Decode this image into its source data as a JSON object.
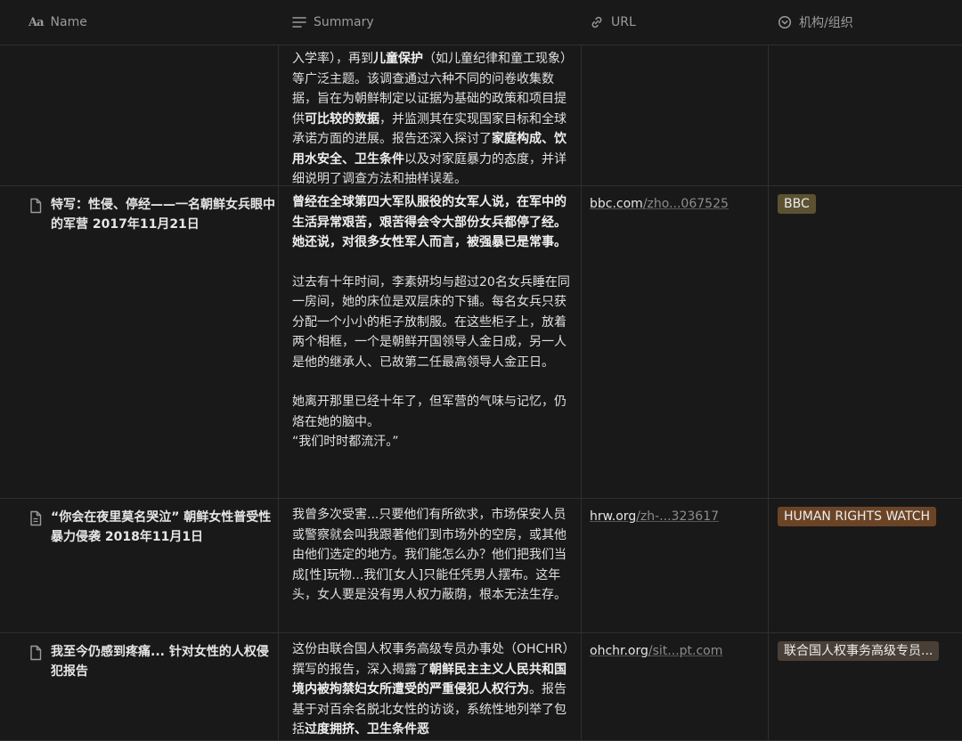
{
  "columns": {
    "name": "Name",
    "summary": "Summary",
    "url": "URL",
    "org": "机构/组织"
  },
  "rows": [
    {
      "name": "",
      "summary": [
        [
          {
            "t": "入学率），再到",
            "b": false
          },
          {
            "t": "儿童保护",
            "b": true
          },
          {
            "t": "（如儿童纪律和童工现象）等广泛主题。该调查通过六种不同的问卷收集数据，旨在为朝鲜制定以证据为基础的政策和项目提供",
            "b": false
          },
          {
            "t": "可比较的数据",
            "b": true
          },
          {
            "t": "，并监测其在实现国家目标和全球承诺方面的进展。报告还深入探讨了",
            "b": false
          },
          {
            "t": "家庭构成、饮用水安全、卫生条件",
            "b": true
          },
          {
            "t": "以及对家庭暴力的态度，并详细说明了调查方法和抽样误差。",
            "b": false
          }
        ]
      ],
      "url_host": "",
      "url_rest": "",
      "org": "",
      "org_color": ""
    },
    {
      "name": "特写：性侵、停经——一名朝鲜女兵眼中的军营 2017年11月21日",
      "summary": [
        [
          {
            "t": "曾经在全球第四大军队服役的女军人说，在军中的生活异常艰苦，艰苦得会令大部份女兵都停了经。她还说，对很多女性军人而言，被强暴已是常事。",
            "b": true
          }
        ],
        [
          {
            "t": "过去有十年时间，李素妍均与超过20名女兵睡在同一房间，她的床位是双层床的下铺。每名女兵只获分配一个小小的柜子放制服。在这些柜子上，放着两个相框，一个是朝鲜开国领导人金日成，另一人是他的继承人、已故第二任最高领导人金正日。",
            "b": false
          }
        ],
        [
          {
            "t": "她离开那里已经十年了，但军营的气味与记忆，仍烙在她的脑中。\n“我们时时都流汗。”",
            "b": false
          }
        ]
      ],
      "url_host": "bbc.com",
      "url_rest": "/zho...067525",
      "org": "BBC",
      "org_color": "#5c5232"
    },
    {
      "name": "“你会在夜里莫名哭泣” 朝鲜女性普受性暴力侵袭 2018年11月1日",
      "summary": [
        [
          {
            "t": "我曾多次受害...只要他们有所欲求，市场保安人员或警察就会叫我跟著他们到市场外的空房，或其他由他们选定的地方。我们能怎么办？他们把我们当成[性]玩物...我们[女人]只能任凭男人摆布。这年头，女人要是没有男人权力蔽荫，根本无法生存。",
            "b": false
          }
        ]
      ],
      "url_host": "hrw.org",
      "url_rest": "/zh-...323617",
      "org": "HUMAN RIGHTS WATCH",
      "org_color": "#6b4426"
    },
    {
      "name": "我至今仍感到疼痛... 针对女性的人权侵犯报告",
      "summary": [
        [
          {
            "t": "这份由联合国人权事务高级专员办事处（OHCHR）撰写的报告，深入揭露了",
            "b": false
          },
          {
            "t": "朝鲜民主主义人民共和国境内被拘禁妇女所遭受的严重侵犯人权行为",
            "b": true
          },
          {
            "t": "。报告基于对百余名脱北女性的访谈，系统性地列举了包括",
            "b": false
          },
          {
            "t": "过度拥挤、卫生条件恶",
            "b": true
          }
        ]
      ],
      "url_host": "ohchr.org",
      "url_rest": "/sit...pt.com",
      "org": "联合国人权事务高级专员...",
      "org_color": "#4a3f36"
    }
  ]
}
